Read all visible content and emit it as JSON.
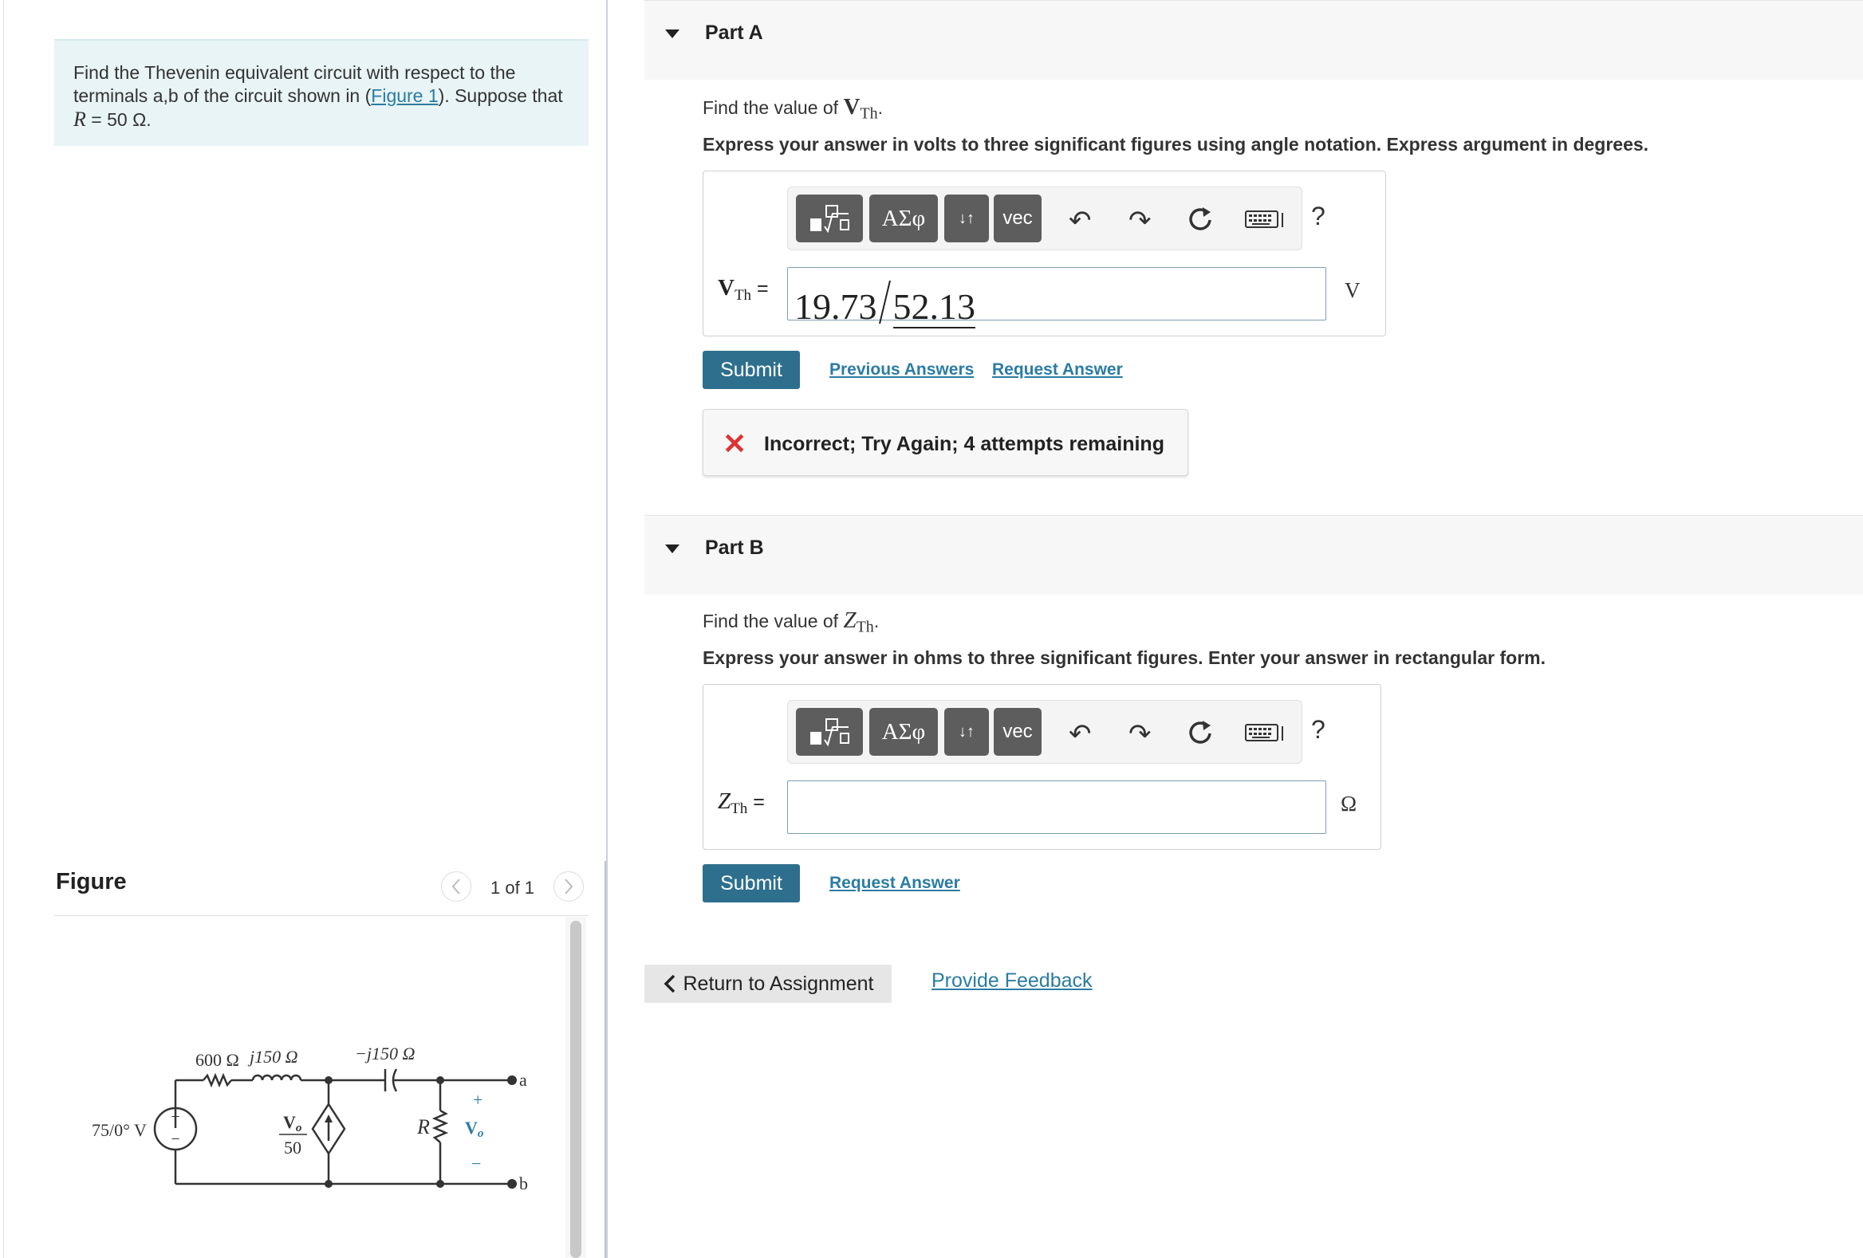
{
  "problem": {
    "text_before_link": "Find the Thevenin equivalent circuit with respect to the terminals a,b of the circuit shown in (",
    "figure_link": "Figure 1",
    "text_after_link": "). Suppose that ",
    "R_symbol": "R",
    "R_value": " = 50 Ω."
  },
  "figure": {
    "title": "Figure",
    "counter": "1 of 1",
    "labels": {
      "source": "75/0° V",
      "r600": "600 Ω",
      "j150": "j150 Ω",
      "minus_j150": "−j150 Ω",
      "dep_num": "V",
      "dep_num_sub": "o",
      "dep_den": "50",
      "R": "R",
      "plus": "+",
      "minus": "−",
      "a": "a",
      "b": "b",
      "Vo": "V",
      "Vo_sub": "o"
    }
  },
  "partA": {
    "title": "Part A",
    "prompt_prefix": "Find the value of ",
    "prompt_var": "V",
    "prompt_sub": "Th",
    "prompt_suffix": ".",
    "instruction": "Express your answer in volts to three significant figures using angle notation. Express argument in degrees.",
    "var_label": "V",
    "var_sub": "Th",
    "equals": "=",
    "magnitude": "19.73",
    "angle": "52.13",
    "unit": "V",
    "submit": "Submit",
    "previous_answers": "Previous Answers",
    "request_answer": "Request Answer",
    "feedback": "Incorrect; Try Again; 4 attempts remaining"
  },
  "partB": {
    "title": "Part B",
    "prompt_prefix": "Find the value of ",
    "prompt_var": "Z",
    "prompt_sub": "Th",
    "prompt_suffix": ".",
    "instruction": "Express your answer in ohms to three significant figures. Enter your answer in rectangular form.",
    "var_label": "Z",
    "var_sub": "Th",
    "equals": "=",
    "input_value": "",
    "unit": "Ω",
    "submit": "Submit",
    "request_answer": "Request Answer"
  },
  "toolbar": {
    "greek": "ΑΣφ",
    "arrows": "↓↑",
    "vec": "vec",
    "help": "?",
    "icons": [
      "templates-icon",
      "greek-icon",
      "arrows-icon",
      "vec-icon",
      "undo-icon",
      "redo-icon",
      "reset-icon",
      "keyboard-icon",
      "help-icon"
    ]
  },
  "nav": {
    "return": "Return to Assignment",
    "feedback": "Provide Feedback"
  },
  "colors": {
    "accent": "#2e6f8e",
    "link": "#2b7ca3",
    "problem_bg": "#e8f4f6",
    "error": "#dd3333"
  }
}
